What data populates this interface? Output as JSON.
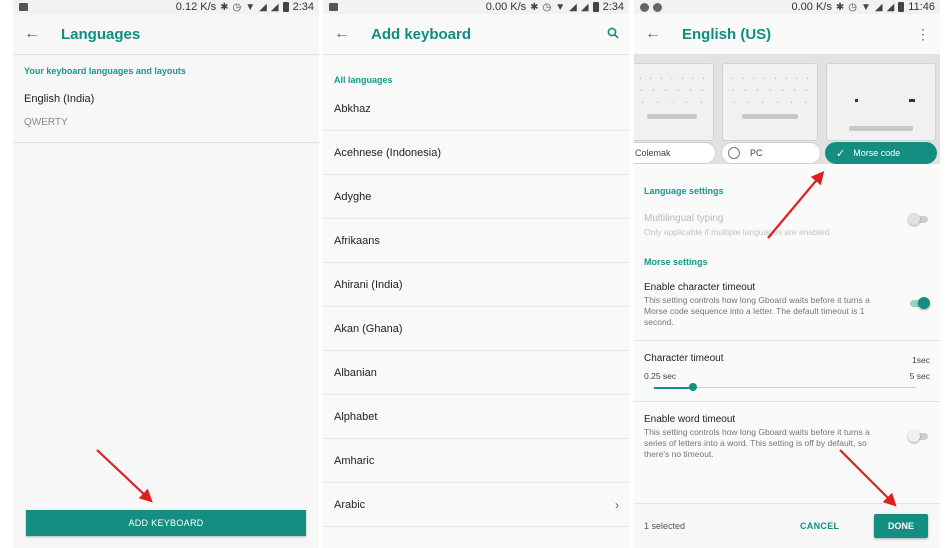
{
  "colors": {
    "accent": "#138e80",
    "arrow": "#e02020"
  },
  "panel1": {
    "status": {
      "speed": "0.12 K/s",
      "time": "2:34"
    },
    "title": "Languages",
    "section": "Your keyboard languages and layouts",
    "language": "English (India)",
    "layout": "QWERTY",
    "add_button": "ADD KEYBOARD"
  },
  "panel2": {
    "status": {
      "speed": "0.00 K/s",
      "time": "2:34"
    },
    "title": "Add keyboard",
    "section": "All languages",
    "languages": [
      "Abkhaz",
      "Acehnese (Indonesia)",
      "Adyghe",
      "Afrikaans",
      "Ahirani (India)",
      "Akan (Ghana)",
      "Albanian",
      "Alphabet",
      "Amharic",
      "Arabic"
    ]
  },
  "panel3": {
    "status": {
      "speed": "0.00 K/s",
      "time": "11:46"
    },
    "title": "English (US)",
    "layouts": {
      "colemak": "Colemak",
      "pc": "PC",
      "morse": "Morse code"
    },
    "language_settings": "Language settings",
    "multilingual": {
      "title": "Multilingual typing",
      "desc": "Only applicable if multiple languages are enabled",
      "on": false
    },
    "morse_settings": "Morse settings",
    "char_timeout": {
      "title": "Enable character timeout",
      "desc": "This setting controls how long Gboard waits before it turns a Morse code sequence into a letter. The default timeout is 1 second.",
      "on": true
    },
    "char_timeout_slider": {
      "title": "Character timeout",
      "value_label": "1sec",
      "min_label": "0.25 sec",
      "max_label": "5 sec",
      "fraction": 0.15
    },
    "word_timeout": {
      "title": "Enable word timeout",
      "desc": "This setting controls how long Gboard waits before it turns a series of letters into a word. This setting is off by default, so there's no timeout.",
      "on": false
    },
    "selected_count": "1 selected",
    "cancel": "CANCEL",
    "done": "DONE"
  }
}
